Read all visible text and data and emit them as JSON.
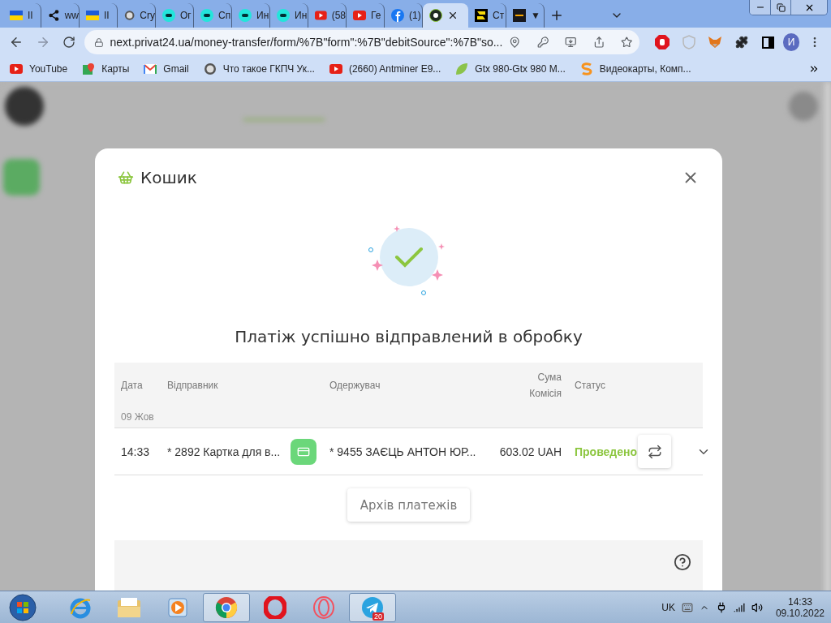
{
  "browser": {
    "tabs": [
      {
        "kind": "flag",
        "title": "ІІ",
        "selected": false
      },
      {
        "kind": "share",
        "title": "ww",
        "selected": false
      },
      {
        "kind": "flag",
        "title": "ІІ",
        "selected": false
      },
      {
        "kind": "coin",
        "title": "Cry",
        "selected": false
      },
      {
        "kind": "olx",
        "title": "Ог",
        "selected": false
      },
      {
        "kind": "olx",
        "title": "Сп",
        "selected": false
      },
      {
        "kind": "olx",
        "title": "Ин",
        "selected": false
      },
      {
        "kind": "olx",
        "title": "Ин",
        "selected": false
      },
      {
        "kind": "youtube",
        "title": "(58",
        "selected": false
      },
      {
        "kind": "youtube",
        "title": "Ге",
        "selected": false
      },
      {
        "kind": "facebook",
        "title": "(1)",
        "selected": false
      },
      {
        "kind": "p24",
        "selected": true
      },
      {
        "kind": "square",
        "title": "Ст",
        "selected": false
      },
      {
        "kind": "bybit",
        "title": "▼",
        "selected": false
      }
    ],
    "address": "next.privat24.ua/money-transfer/form/%7B\"form\":%7B\"debitSource\":%7B\"so...",
    "profile_initial": "И",
    "bookmarks": [
      {
        "kind": "youtube",
        "label": "YouTube"
      },
      {
        "kind": "maps",
        "label": "Карты"
      },
      {
        "kind": "gmail",
        "label": "Gmail"
      },
      {
        "kind": "coin",
        "label": "Что такое ГКПЧ Ук..."
      },
      {
        "kind": "youtube",
        "label": "(2660) Antminer E9..."
      },
      {
        "kind": "leaf",
        "label": "Gtx 980-Gtx 980 M..."
      },
      {
        "kind": "s",
        "label": "Видеокарты, Комп..."
      }
    ]
  },
  "modal": {
    "title": "Кошик",
    "message": "Платіж успішно відправлений в обробку",
    "table": {
      "columns": [
        {
          "label": "Дата"
        },
        {
          "label": "Відправник"
        },
        {
          "label": "Одержувач"
        },
        {
          "label": "Сума",
          "sublabel": "Комісія"
        },
        {
          "label": "Статус"
        }
      ],
      "group": "09 Жов",
      "rows": [
        {
          "time": "14:33",
          "sender": "* 2892 Картка для в...",
          "recipient": "* 9455 ЗАЄЦЬ АНТОН ЮР...",
          "amount": "603.02 UAH",
          "status": "Проведено"
        }
      ]
    },
    "archive_button": "Архів платежів"
  },
  "taskbar": {
    "apps": [
      {
        "kind": "ie",
        "selected": false
      },
      {
        "kind": "explorer",
        "selected": false
      },
      {
        "kind": "media",
        "selected": false
      },
      {
        "kind": "chrome",
        "selected": true
      },
      {
        "kind": "opera",
        "selected": false
      },
      {
        "kind": "operagx",
        "selected": false
      },
      {
        "kind": "telegram",
        "selected": true,
        "badge": "20"
      }
    ],
    "language": "UK",
    "time": "14:33",
    "date": "09.10.2022"
  }
}
